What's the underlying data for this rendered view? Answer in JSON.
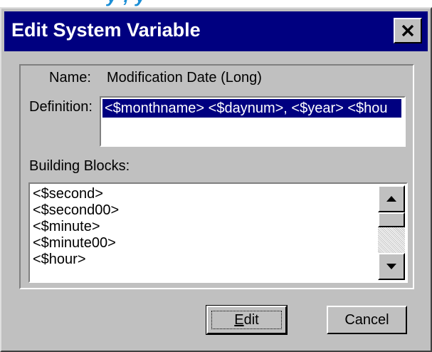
{
  "window": {
    "title": "Edit System Variable",
    "close_glyph": "×"
  },
  "top_strip_text": "y       ,     y",
  "name": {
    "label": "Name:",
    "value": "Modification Date (Long)"
  },
  "definition": {
    "label": "Definition:",
    "value": "<$monthname> <$daynum>, <$year> <$hou"
  },
  "building_blocks": {
    "label": "Building Blocks:",
    "items": [
      "<$second>",
      "<$second00>",
      "<$minute>",
      "<$minute00>",
      "<$hour>"
    ]
  },
  "buttons": {
    "edit_mnemonic": "E",
    "edit_rest": "dit",
    "cancel": "Cancel"
  },
  "colors": {
    "titlebar": "#000080",
    "face": "#c0c0c0",
    "selection": "#000080",
    "top_strip_text": "#1c8fd6"
  }
}
